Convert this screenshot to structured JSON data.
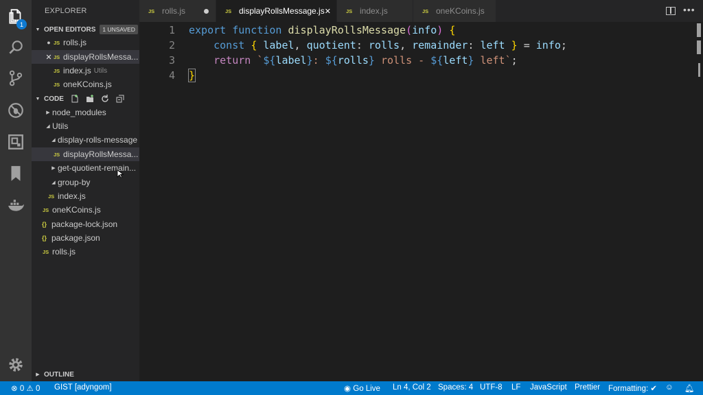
{
  "explorer": {
    "title": "EXPLORER",
    "open_editors": {
      "header": "OPEN EDITORS",
      "unsaved_badge": "1 UNSAVED",
      "items": [
        {
          "icon": "JS",
          "name": "rolls.js",
          "description": ""
        },
        {
          "icon": "JS",
          "name": "displayRollsMessa...",
          "description": ""
        },
        {
          "icon": "JS",
          "name": "index.js",
          "description": "Utils"
        },
        {
          "icon": "JS",
          "name": "oneKCoins.js",
          "description": ""
        }
      ]
    },
    "workspace": {
      "header": "CODE",
      "tree": [
        {
          "name": "node_modules"
        },
        {
          "name": "Utils"
        },
        {
          "name": "display-rolls-message"
        },
        {
          "icon": "JS",
          "name": "displayRollsMessa..."
        },
        {
          "name": "get-quotient-remain..."
        },
        {
          "name": "group-by"
        },
        {
          "icon": "JS",
          "name": "index.js"
        },
        {
          "icon": "JS",
          "name": "oneKCoins.js"
        },
        {
          "icon": "{}",
          "name": "package-lock.json"
        },
        {
          "icon": "{}",
          "name": "package.json"
        },
        {
          "icon": "JS",
          "name": "rolls.js"
        }
      ]
    },
    "outline_header": "OUTLINE"
  },
  "activity_bar": {
    "badge": "1",
    "icons": [
      "files-icon",
      "search-icon",
      "source-control-icon",
      "debug-icon",
      "extensions-icon",
      "bookmark-icon",
      "docker-icon",
      "settings-gear-icon"
    ]
  },
  "tabs": [
    {
      "icon": "JS",
      "label": "rolls.js",
      "dirty": true,
      "active": false
    },
    {
      "icon": "JS",
      "label": "displayRollsMessage.js",
      "dirty": false,
      "active": true
    },
    {
      "icon": "JS",
      "label": "index.js",
      "dirty": false,
      "active": false
    },
    {
      "icon": "JS",
      "label": "oneKCoins.js",
      "dirty": false,
      "active": false
    }
  ],
  "editor": {
    "line_numbers": [
      "1",
      "2",
      "3",
      "4"
    ],
    "lines": [
      "export function displayRollsMessage(info) {",
      "    const { label, quotient: rolls, remainder: left } = info;",
      "    return `${label}: ${rolls} rolls - ${left} left`;",
      "}"
    ]
  },
  "status_bar": {
    "errors": "0",
    "warnings": "0",
    "gist": "GIST [adyngom]",
    "go_live": "Go Live",
    "position": "Ln 4, Col 2",
    "spaces": "Spaces: 4",
    "encoding": "UTF-8",
    "eol": "LF",
    "language": "JavaScript",
    "prettier": "Prettier",
    "formatting": "Formatting:"
  },
  "colors": {
    "activity_bar": "#333333",
    "sidebar": "#252526",
    "editor": "#1e1e1e",
    "status_bar": "#007acc",
    "js_icon": "#cbcb41"
  }
}
